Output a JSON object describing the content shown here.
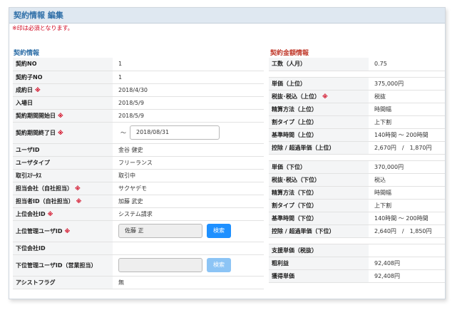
{
  "header": {
    "title": "契約情報 編集"
  },
  "required_note": "※印は必須となります。",
  "required_mark": "※",
  "sections": {
    "left_title": "契約情報",
    "right_title": "契約金額情報"
  },
  "left_rows": [
    {
      "label": "契約NO",
      "value": "1",
      "required": false
    },
    {
      "label": "契約子NO",
      "value": "1",
      "required": false
    },
    {
      "label": "成約日",
      "value": "2018/4/30",
      "required": true
    },
    {
      "label": "入場日",
      "value": "2018/5/9",
      "required": false
    },
    {
      "label": "契約期間開始日",
      "value": "2018/5/9",
      "required": true
    },
    {
      "label": "契約期間終了日",
      "tilde": "〜",
      "input_value": "2018/08/31",
      "required": true
    },
    {
      "label": "ユーザID",
      "value": "金谷 健史",
      "required": false
    },
    {
      "label": "ユーザタイプ",
      "value": "フリーランス",
      "required": false
    },
    {
      "label": "取引ｽﾃｰﾀｽ",
      "value": "取引中",
      "required": false
    },
    {
      "label": "担当会社（自社担当）",
      "value": "サクヤデモ",
      "required": true
    },
    {
      "label": "担当者ID（自社担当）",
      "value": "加藤 武史",
      "required": true
    },
    {
      "label": "上位会社ID",
      "value": "システム請求",
      "required": true
    },
    {
      "label": "上位管理ユーザID",
      "input_value": "佐藤 正",
      "button": "検索",
      "required": true
    },
    {
      "label": "下位会社ID",
      "value": "",
      "required": false
    },
    {
      "label": "下位管理ユーザID（営業担当）",
      "input_value": "",
      "button": "検索",
      "required": false
    },
    {
      "label": "アシストフラグ",
      "value": "無",
      "required": false
    }
  ],
  "right_groups": [
    [
      {
        "label": "工数（人月）",
        "value": "0.75"
      }
    ],
    [
      {
        "label": "単価（上位）",
        "value": "375,000円"
      },
      {
        "label": "税抜･税込（上位）",
        "value": "税抜",
        "required": true
      },
      {
        "label": "精算方法（上位）",
        "value": "時間幅"
      },
      {
        "label": "割タイプ（上位）",
        "value": "上下割"
      },
      {
        "label": "基準時間（上位）",
        "value": "140時間 〜 200時間"
      },
      {
        "label": "控除 / 超過単価（上位）",
        "value": "2,670円　/　1,870円"
      }
    ],
    [
      {
        "label": "単価（下位）",
        "value": "370,000円"
      },
      {
        "label": "税抜･税込（下位）",
        "value": "税込"
      },
      {
        "label": "精算方法（下位）",
        "value": "時間幅"
      },
      {
        "label": "割タイプ（下位）",
        "value": "上下割"
      },
      {
        "label": "基準時間（下位）",
        "value": "140時間 〜 200時間"
      },
      {
        "label": "控除 / 超過単価（下位）",
        "value": "2,640円　/　1,850円"
      }
    ],
    [
      {
        "label": "支援単価（税抜）",
        "value": ""
      },
      {
        "label": "粗利益",
        "value": "92,408円"
      },
      {
        "label": "獲得単価",
        "value": "92,408円"
      }
    ]
  ]
}
